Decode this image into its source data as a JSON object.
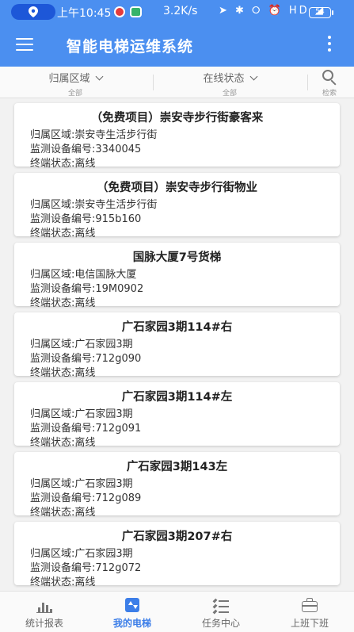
{
  "status_bar": {
    "time": "上午10:45",
    "net_speed": "3.2K/s",
    "icons": "➤ ✱ ⭘ ⏰ HD ◢",
    "battery": "54"
  },
  "app_bar": {
    "title": "智能电梯运维系统"
  },
  "filters": {
    "area": {
      "label": "归属区域",
      "value": "全部"
    },
    "state": {
      "label": "在线状态",
      "value": "全部"
    },
    "search": {
      "label": "检索"
    }
  },
  "devices": [
    {
      "title": "（免费项目）崇安寺步行街豪客来",
      "area": "归属区域:崇安寺生活步行街",
      "device_no": "监测设备编号:3340045",
      "status": "终端状态:离线"
    },
    {
      "title": "（免费项目）崇安寺步行街物业",
      "area": "归属区域:崇安寺生活步行街",
      "device_no": "监测设备编号:915b160",
      "status": "终端状态:离线"
    },
    {
      "title": "国脉大厦7号货梯",
      "area": "归属区域:电信国脉大厦",
      "device_no": "监测设备编号:19M0902",
      "status": "终端状态:离线"
    },
    {
      "title": "广石家园3期114#右",
      "area": "归属区域:广石家园3期",
      "device_no": "监测设备编号:712g090",
      "status": "终端状态:离线"
    },
    {
      "title": "广石家园3期114#左",
      "area": "归属区域:广石家园3期",
      "device_no": "监测设备编号:712g091",
      "status": "终端状态:离线"
    },
    {
      "title": "广石家园3期143左",
      "area": "归属区域:广石家园3期",
      "device_no": "监测设备编号:712g089",
      "status": "终端状态:离线"
    },
    {
      "title": "广石家园3期207#右",
      "area": "归属区域:广石家园3期",
      "device_no": "监测设备编号:712g072",
      "status": "终端状态:离线"
    }
  ],
  "bottom_nav": {
    "stats": "统计报表",
    "elevator": "我的电梯",
    "tasks": "任务中心",
    "duty": "上班下班"
  },
  "colors": {
    "primary": "#4b8ff0",
    "active_tab": "#3c7ee8"
  }
}
